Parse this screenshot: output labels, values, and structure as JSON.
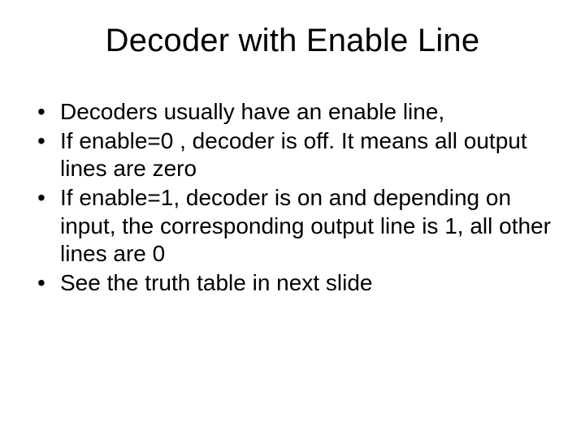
{
  "slide": {
    "title": "Decoder with Enable Line",
    "bullets": [
      "Decoders usually have an enable line,",
      "If enable=0 , decoder is off. It means all output lines are zero",
      "If enable=1, decoder is on and depending on input, the corresponding output line is 1, all other lines are 0",
      "See the truth table in next slide"
    ]
  }
}
